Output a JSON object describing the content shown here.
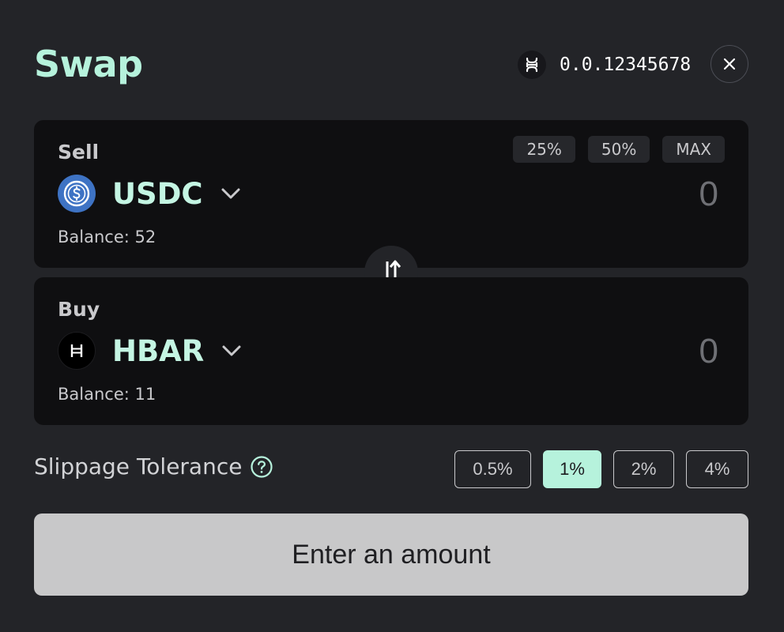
{
  "header": {
    "title": "Swap",
    "account_id": "0.0.12345678",
    "account_icon": "hashpack-wallet-icon",
    "close_icon": "close-icon"
  },
  "sell": {
    "label": "Sell",
    "token": {
      "symbol": "USDC",
      "icon": "usdc-logo-icon"
    },
    "amount": "0",
    "balance": "Balance: 52",
    "quick_amounts": [
      "25%",
      "50%",
      "MAX"
    ]
  },
  "buy": {
    "label": "Buy",
    "token": {
      "symbol": "HBAR",
      "icon": "hbar-logo-icon"
    },
    "amount": "0",
    "balance": "Balance: 11"
  },
  "swap_direction_icon": "swap-vertical-arrows-icon",
  "slippage": {
    "label": "Slippage Tolerance",
    "help_icon": "question-circle-icon",
    "options": [
      "0.5%",
      "1%",
      "2%",
      "4%"
    ],
    "selected": "1%"
  },
  "submit": {
    "label": "Enter an amount"
  },
  "colors": {
    "background": "#232428",
    "card": "#0f0f11",
    "accent": "#b6f2dc",
    "usdc_blue": "#3e73c4",
    "submit_disabled": "#c8c8c9"
  }
}
